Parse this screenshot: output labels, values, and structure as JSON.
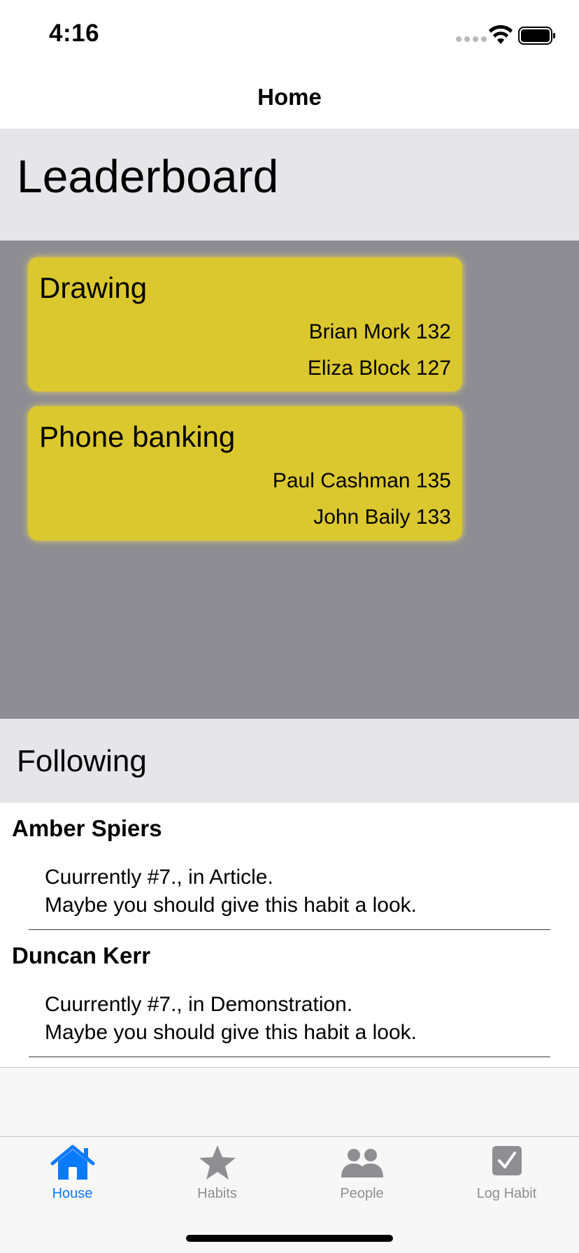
{
  "status_bar": {
    "time": "4:16",
    "icons": [
      "signal-dots-icon",
      "wifi-icon",
      "battery-icon"
    ]
  },
  "nav": {
    "title": "Home"
  },
  "leaderboard": {
    "title": "Leaderboard",
    "cards": [
      {
        "title": "Drawing",
        "entries": [
          "Brian Mork 132",
          "Eliza Block 127"
        ]
      },
      {
        "title": "Phone banking",
        "entries": [
          "Paul Cashman 135",
          "John Baily 133"
        ]
      }
    ]
  },
  "following": {
    "title": "Following",
    "items": [
      {
        "name": "Amber Spiers",
        "line1": "Cuurrently #7., in Article.",
        "line2": "Maybe you should give this habit a look."
      },
      {
        "name": "Duncan Kerr",
        "line1": "Cuurrently #7., in Demonstration.",
        "line2": "Maybe you should give this habit a look."
      }
    ]
  },
  "tab_bar": {
    "tabs": [
      {
        "label": "House",
        "icon": "house-icon",
        "selected": true
      },
      {
        "label": "Habits",
        "icon": "star-icon",
        "selected": false
      },
      {
        "label": "People",
        "icon": "people-icon",
        "selected": false
      },
      {
        "label": "Log Habit",
        "icon": "checkmark-square-icon",
        "selected": false
      }
    ]
  },
  "colors": {
    "accent": "#0a7aff",
    "card": "#dbc82e",
    "leaderboard_background": "#8e8d93",
    "section_header": "#e5e5ea",
    "tab_inactive": "#8e8e93"
  }
}
